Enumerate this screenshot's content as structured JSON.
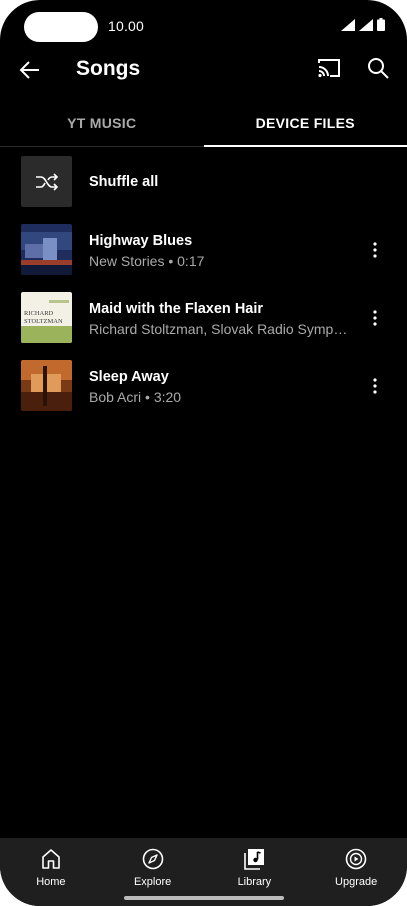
{
  "status_bar": {
    "time": "10.00"
  },
  "app_bar": {
    "title": "Songs"
  },
  "tabs": [
    {
      "label": "YT MUSIC",
      "active": false
    },
    {
      "label": "DEVICE FILES",
      "active": true
    }
  ],
  "shuffle": {
    "label": "Shuffle all"
  },
  "songs": [
    {
      "title": "Highway Blues",
      "subtitle": "New Stories • 0:17"
    },
    {
      "title": "Maid with the Flaxen Hair",
      "subtitle": "Richard Stoltzman, Slovak Radio Symp…",
      "art_text_1": "RICHARD",
      "art_text_2": "STOLTZMAN"
    },
    {
      "title": "Sleep Away",
      "subtitle": "Bob Acri • 3:20"
    }
  ],
  "bottom_nav": [
    {
      "label": "Home",
      "icon": "home-icon"
    },
    {
      "label": "Explore",
      "icon": "compass-icon"
    },
    {
      "label": "Library",
      "icon": "library-icon"
    },
    {
      "label": "Upgrade",
      "icon": "upgrade-icon"
    }
  ],
  "colors": {
    "background": "#000000",
    "nav_background": "#1f1f1f",
    "secondary_text": "#aaaaaa"
  }
}
